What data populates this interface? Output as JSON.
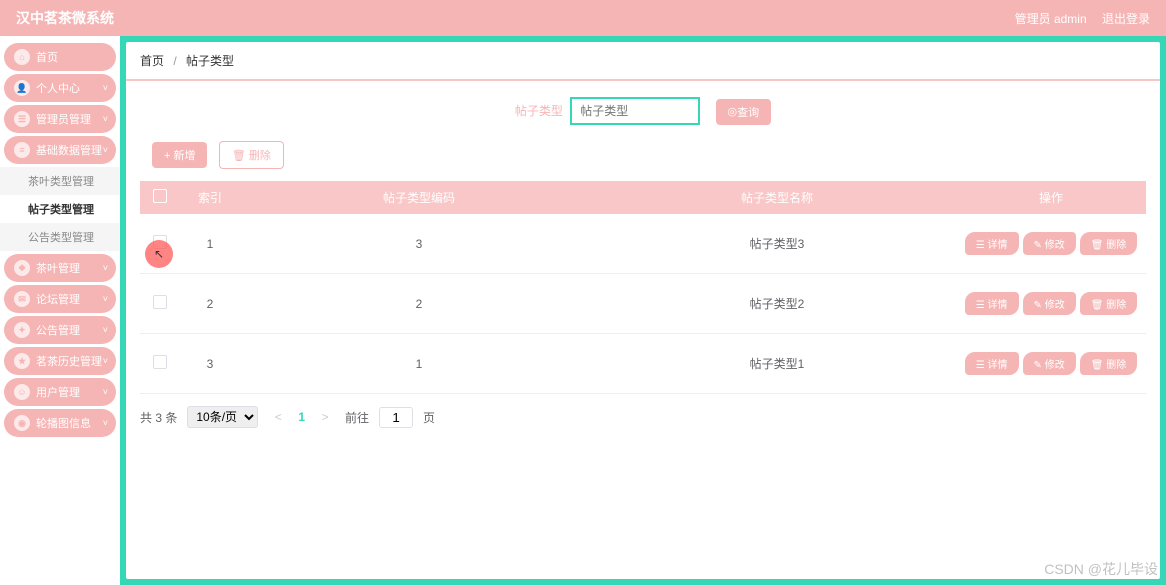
{
  "topbar": {
    "title": "汉中茗茶微系统",
    "admin": "管理员 admin",
    "logout": "退出登录"
  },
  "sidebar": {
    "items": [
      {
        "label": "首页"
      },
      {
        "label": "个人中心"
      },
      {
        "label": "管理员管理"
      },
      {
        "label": "基础数据管理"
      },
      {
        "label": "茶叶管理"
      },
      {
        "label": "论坛管理"
      },
      {
        "label": "公告管理"
      },
      {
        "label": "茗茶历史管理"
      },
      {
        "label": "用户管理"
      },
      {
        "label": "轮播图信息"
      }
    ],
    "sub": {
      "a": "茶叶类型管理",
      "b": "帖子类型管理",
      "c": "公告类型管理"
    }
  },
  "breadcrumb": {
    "home": "首页",
    "current": "帖子类型"
  },
  "search": {
    "label": "帖子类型",
    "placeholder": "帖子类型",
    "button": "查询"
  },
  "toolbar": {
    "add": "+ 新增",
    "del": "🗑 删除"
  },
  "table": {
    "headers": {
      "idx": "索引",
      "code": "帖子类型编码",
      "name": "帖子类型名称",
      "op": "操作"
    },
    "rows": [
      {
        "idx": "1",
        "code": "3",
        "name": "帖子类型3"
      },
      {
        "idx": "2",
        "code": "2",
        "name": "帖子类型2"
      },
      {
        "idx": "3",
        "code": "1",
        "name": "帖子类型1"
      }
    ],
    "ops": {
      "detail": "详情",
      "edit": "修改",
      "del": "删除"
    }
  },
  "pagination": {
    "total": "共 3 条",
    "pageSize": "10条/页",
    "current": "1",
    "goto": "前往",
    "page": "页",
    "gotoVal": "1"
  },
  "watermark": "CSDN @花儿毕设"
}
